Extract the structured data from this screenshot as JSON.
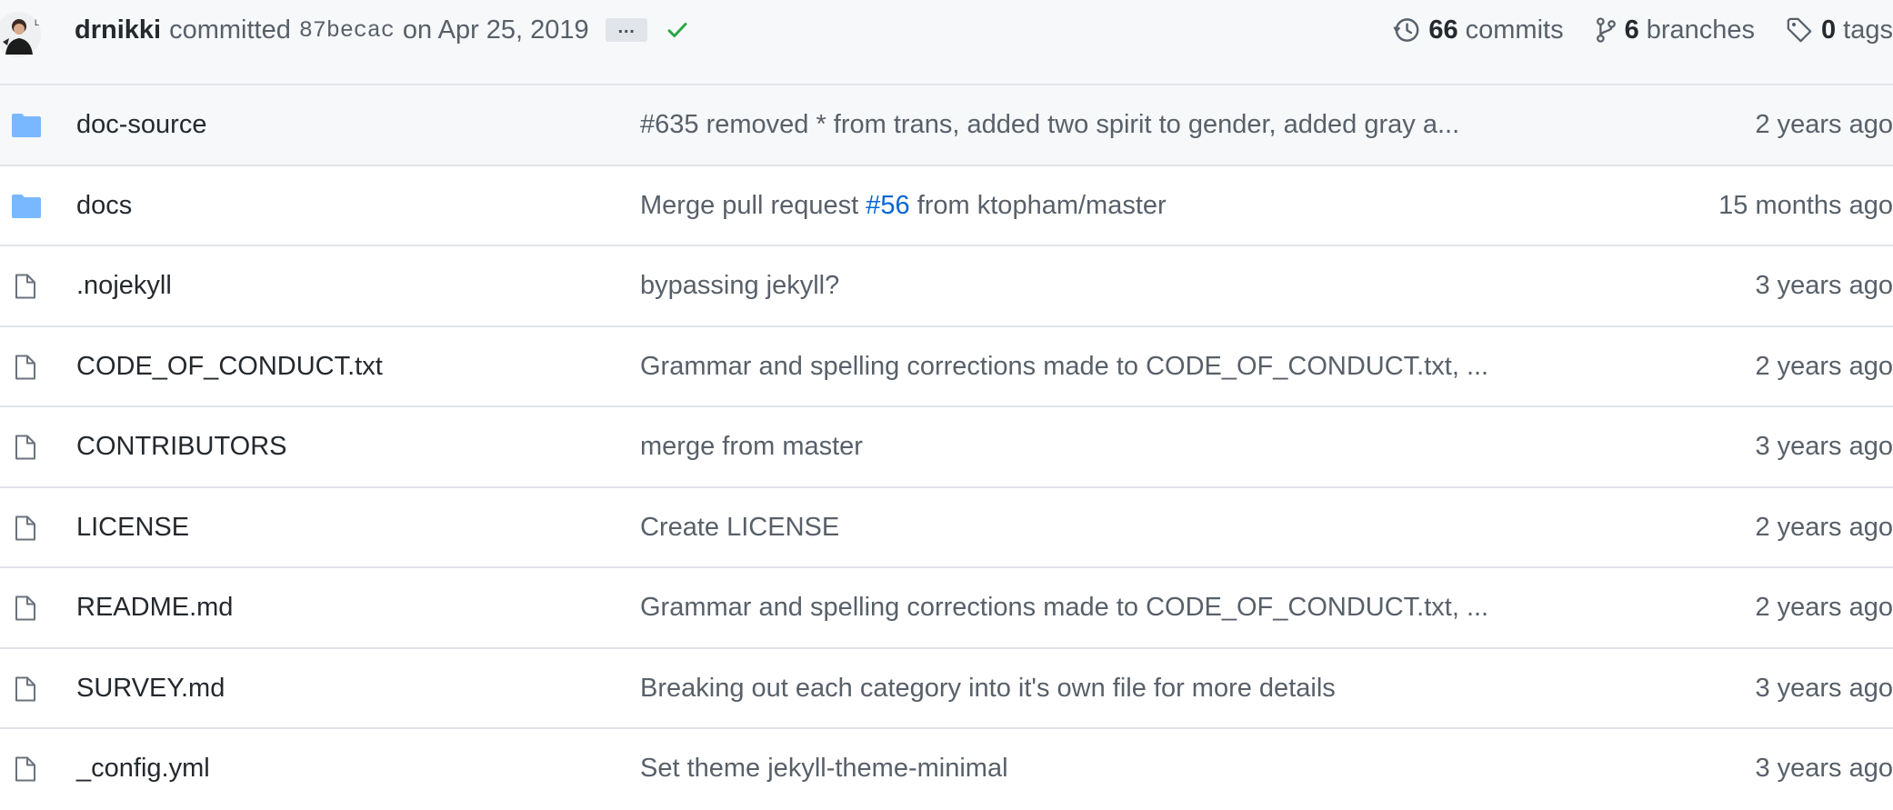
{
  "header": {
    "author": "drnikki",
    "committed_label": "committed",
    "sha": "87becac",
    "date_text": "on Apr 25, 2019",
    "ellipsis": "…",
    "status": "success",
    "commits": {
      "count": "66",
      "label": "commits"
    },
    "branches": {
      "count": "6",
      "label": "branches"
    },
    "tags": {
      "count": "0",
      "label": "tags"
    }
  },
  "colors": {
    "folder": "#79b8ff",
    "link": "#0366d6",
    "check": "#28a745",
    "muted": "#586069"
  },
  "files": [
    {
      "type": "folder",
      "icon": "folder-icon",
      "name": "doc-source",
      "message": "#635 removed * from trans, added two spirit to gender, added gray a...",
      "age": "2 years ago"
    },
    {
      "type": "folder",
      "icon": "folder-icon",
      "name": "docs",
      "message_before": "Merge pull request ",
      "message_link": "#56",
      "message_after": " from ktopham/master",
      "age": "15 months ago"
    },
    {
      "type": "file",
      "icon": "file-icon",
      "name": ".nojekyll",
      "message": "bypassing jekyll?",
      "age": "3 years ago"
    },
    {
      "type": "file",
      "icon": "file-icon",
      "name": "CODE_OF_CONDUCT.txt",
      "message": "Grammar and spelling corrections made to CODE_OF_CONDUCT.txt, ...",
      "age": "2 years ago"
    },
    {
      "type": "file",
      "icon": "file-icon",
      "name": "CONTRIBUTORS",
      "message": "merge from master",
      "age": "3 years ago"
    },
    {
      "type": "file",
      "icon": "file-icon",
      "name": "LICENSE",
      "message": "Create LICENSE",
      "age": "2 years ago"
    },
    {
      "type": "file",
      "icon": "file-icon",
      "name": "README.md",
      "message": "Grammar and spelling corrections made to CODE_OF_CONDUCT.txt, ...",
      "age": "2 years ago"
    },
    {
      "type": "file",
      "icon": "file-icon",
      "name": "SURVEY.md",
      "message": "Breaking out each category into it's own file for more details",
      "age": "3 years ago"
    },
    {
      "type": "file",
      "icon": "file-icon",
      "name": "_config.yml",
      "message": "Set theme jekyll-theme-minimal",
      "age": "3 years ago"
    }
  ]
}
